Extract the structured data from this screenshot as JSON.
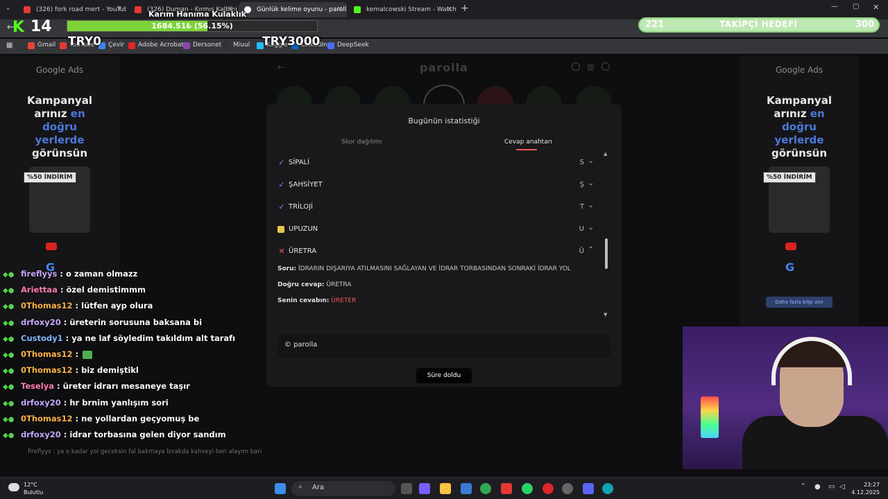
{
  "tabs": [
    {
      "label": "(326) fork road mert - YouTube",
      "color": "#e53935"
    },
    {
      "label": "(326) Duman - Kırmış Kalbini",
      "color": "#e53935"
    },
    {
      "label": "Günlük kelime oyunu - parolla",
      "color": "#ffffff"
    },
    {
      "label": "kemalcowski Stream - Watch L",
      "color": "#53fc18"
    }
  ],
  "bookmarks": [
    "Gmail",
    "YouTube",
    "Çevir",
    "Adobe Acrobat",
    "Dersonet",
    "Miuul",
    "Kaggle",
    "LinkedIn",
    "DeepSeek"
  ],
  "overlay": {
    "kick_num": "14",
    "progress_title": "Karım Hanıma Kulaklık",
    "progress_text": "1684.51₺ (56.15%)",
    "progress_pct": 56.15,
    "try_left": "TRY0",
    "try_right": "TRY3000",
    "goal_current": "221",
    "goal_label": "TAKİPÇİ HEDEFİ",
    "goal_max": "300"
  },
  "ads": {
    "google": "Google Ads",
    "line1": "Kampanyal",
    "line2": "arınız",
    "line2b": "en",
    "line3": "doğru",
    "line4": "yerlerde",
    "line5": "görünsün",
    "badge": "%50 İNDİRİM",
    "more": "Daha fazla bilgi alın"
  },
  "app": {
    "title": "parolla"
  },
  "modal": {
    "title": "Bugünün istatistiği",
    "tab1": "Skor dağılımı",
    "tab2": "Cevap anahtarı",
    "rows": [
      {
        "word": "SİPALİ",
        "letter": "S",
        "status": "correct"
      },
      {
        "word": "ŞAHSİYET",
        "letter": "Ş",
        "status": "correct"
      },
      {
        "word": "TRİLOJİ",
        "letter": "T",
        "status": "correct"
      },
      {
        "word": "UPUZUN",
        "letter": "U",
        "status": "pass"
      },
      {
        "word": "ÜRETRA",
        "letter": "Ü",
        "status": "wrong"
      }
    ],
    "soru_label": "Soru:",
    "soru": "İDRARIN DIŞARIYA ATILMASINI SAĞLAYAN VE İDRAR TORBASINDAN SONRAKİ İDRAR YOL",
    "dogru_label": "Doğru cevap:",
    "dogru": "ÜRETRA",
    "senin_label": "Senin cevabın:",
    "senin": "ÜRETER",
    "footer": "© parolla",
    "button": "Süre doldu"
  },
  "chat": [
    {
      "user": "fireflyys",
      "color": "#c7a7ff",
      "text": ": o zaman olmazz"
    },
    {
      "user": "Ariettaa",
      "color": "#ff7fb0",
      "text": ": özel demistimmm"
    },
    {
      "user": "0Thomas12",
      "color": "#ffb347",
      "text": ": lütfen ayp olura"
    },
    {
      "user": "drfoxy20",
      "color": "#c7a7ff",
      "text": ": üreterin sorusuna baksana bi"
    },
    {
      "user": "Custody1",
      "color": "#7fb7ff",
      "text": ": ya ne laf söyledim takıldım alt tarafı"
    },
    {
      "user": "0Thomas12",
      "color": "#ffb347",
      "text": ":"
    },
    {
      "user": "0Thomas12",
      "color": "#ffb347",
      "text": ": biz demiştikl"
    },
    {
      "user": "Teselya",
      "color": "#ff7fb0",
      "text": ": üreter idrarı mesaneye taşır"
    },
    {
      "user": "drfoxy20",
      "color": "#c7a7ff",
      "text": ": hr brnim yanlışım sori"
    },
    {
      "user": "0Thomas12",
      "color": "#ffb347",
      "text": ": ne yollardan geçyomuş be"
    },
    {
      "user": "drfoxy20",
      "color": "#c7a7ff",
      "text": ": idrar torbasına gelen diyor sandım"
    }
  ],
  "chat_faded": "fireflyys : ya o kadar yol geceksin fal bakmaya bırakda kahveyi ben alayım bari",
  "taskbar": {
    "search": "Ara",
    "temp": "12°C",
    "weather": "Bulutlu",
    "time": "23:27",
    "date": "4.12.2025"
  }
}
